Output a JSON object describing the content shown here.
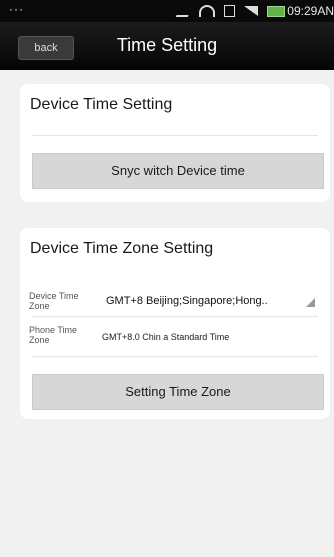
{
  "status_bar": {
    "dots": "···",
    "time": "09:29AN"
  },
  "header": {
    "back_label": "back",
    "title": "Time Setting"
  },
  "device_time": {
    "title": "Device Time Setting",
    "sync_button": "Snyc witch Device time"
  },
  "time_zone": {
    "title": "Device Time Zone Setting",
    "device_tz_label": "Device Time Zone",
    "device_tz_value": "GMT+8 Beijing;Singapore;Hong..",
    "phone_tz_label": "Phone Time Zone",
    "phone_tz_value": "GMT+8.0  Chin a Standard Time",
    "set_button": "Setting Time Zone"
  }
}
